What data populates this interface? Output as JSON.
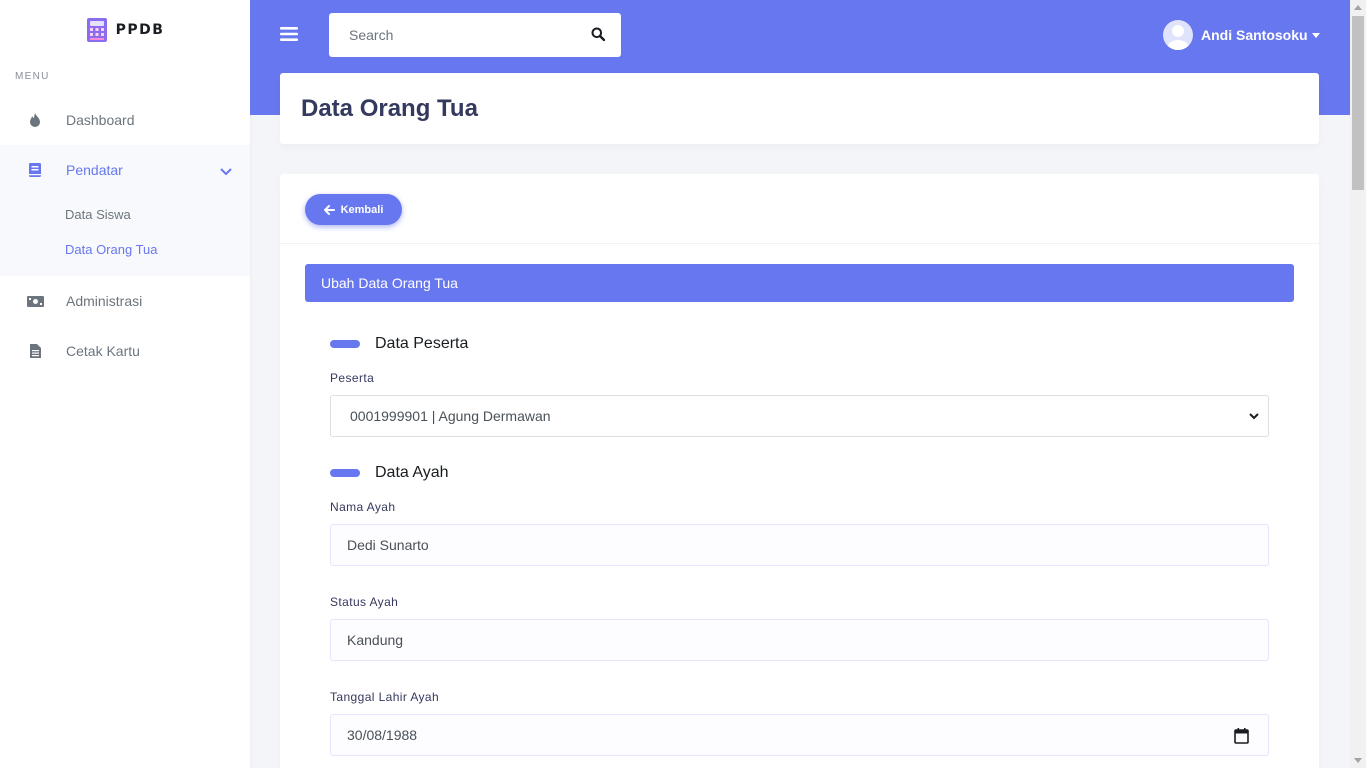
{
  "brand": {
    "name": "PPDB"
  },
  "sidebar": {
    "menu_header": "MENU",
    "items": [
      {
        "label": "Dashboard",
        "icon": "fire-icon"
      },
      {
        "label": "Pendatar",
        "icon": "book-icon"
      },
      {
        "label": "Administrasi",
        "icon": "money-icon"
      },
      {
        "label": "Cetak Kartu",
        "icon": "file-icon"
      }
    ],
    "submenu": [
      {
        "label": "Data Siswa"
      },
      {
        "label": "Data Orang Tua"
      }
    ]
  },
  "topbar": {
    "search_placeholder": "Search",
    "user_name": "Andi Santosoku"
  },
  "page": {
    "title": "Data Orang Tua"
  },
  "card": {
    "back_label": "Kembali",
    "form_title": "Ubah Data Orang Tua",
    "section_peserta": "Data Peserta",
    "peserta_label": "Peserta",
    "peserta_value": "0001999901 | Agung Dermawan",
    "section_ayah": "Data Ayah",
    "nama_ayah_label": "Nama Ayah",
    "nama_ayah_value": "Dedi Sunarto",
    "status_ayah_label": "Status Ayah",
    "status_ayah_value": "Kandung",
    "tgl_lahir_label": "Tanggal Lahir Ayah",
    "tgl_lahir_value": "30/08/1988"
  },
  "colors": {
    "primary": "#6777ef",
    "text_dark": "#34395e",
    "muted": "#6c757d"
  }
}
